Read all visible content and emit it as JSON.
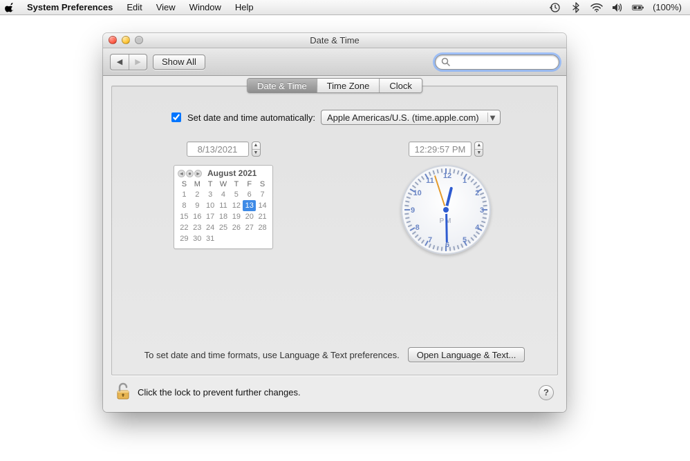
{
  "menubar": {
    "app_name": "System Preferences",
    "items": [
      "Edit",
      "View",
      "Window",
      "Help"
    ],
    "battery_text": "(100%)"
  },
  "window": {
    "title": "Date & Time",
    "show_all_label": "Show All",
    "search_placeholder": ""
  },
  "tabs": {
    "items": [
      "Date & Time",
      "Time Zone",
      "Clock"
    ],
    "active_index": 0
  },
  "auto": {
    "checked": true,
    "label": "Set date and time automatically:",
    "server": "Apple Americas/U.S. (time.apple.com)"
  },
  "date": {
    "value": "8/13/2021",
    "month_label": "August 2021",
    "dow": [
      "S",
      "M",
      "T",
      "W",
      "T",
      "F",
      "S"
    ],
    "days": [
      1,
      2,
      3,
      4,
      5,
      6,
      7,
      8,
      9,
      10,
      11,
      12,
      13,
      14,
      15,
      16,
      17,
      18,
      19,
      20,
      21,
      22,
      23,
      24,
      25,
      26,
      27,
      28,
      29,
      30,
      31
    ],
    "today": 13
  },
  "time": {
    "value": "12:29:57 PM",
    "ampm": "PM",
    "hour_angle": 14,
    "minute_angle": 179,
    "second_angle": 342
  },
  "formats": {
    "hint": "To set date and time formats, use Language & Text preferences.",
    "button": "Open Language & Text..."
  },
  "lock": {
    "text": "Click the lock to prevent further changes."
  }
}
